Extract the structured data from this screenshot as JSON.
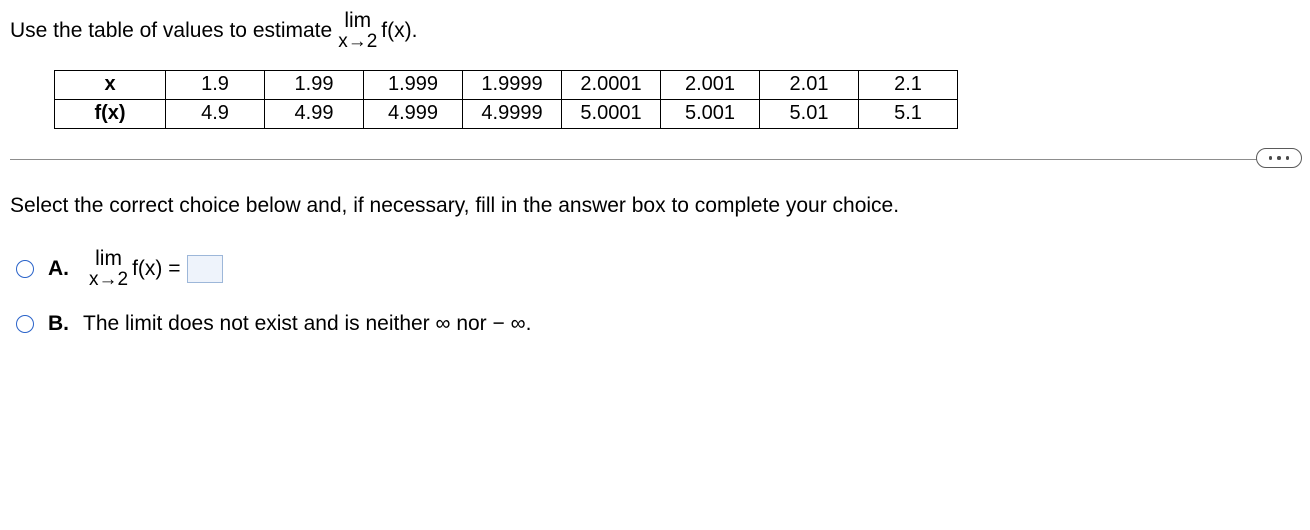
{
  "prompt": {
    "before": "Use the table of values to estimate",
    "lim_top": "lim",
    "lim_bottom": "x→2",
    "after": "f(x)."
  },
  "table": {
    "row1_header": "x",
    "row1": [
      "1.9",
      "1.99",
      "1.999",
      "1.9999",
      "2.0001",
      "2.001",
      "2.01",
      "2.1"
    ],
    "row2_header": "f(x)",
    "row2": [
      "4.9",
      "4.99",
      "4.999",
      "4.9999",
      "5.0001",
      "5.001",
      "5.01",
      "5.1"
    ]
  },
  "instruction": "Select the correct choice below and, if necessary, fill in the answer box to complete your choice.",
  "choices": {
    "a_letter": "A.",
    "a_lim_top": "lim",
    "a_lim_bottom": "x→2",
    "a_after": "f(x) =",
    "b_letter": "B.",
    "b_text": "The limit does not exist and is neither ∞ nor  − ∞."
  }
}
